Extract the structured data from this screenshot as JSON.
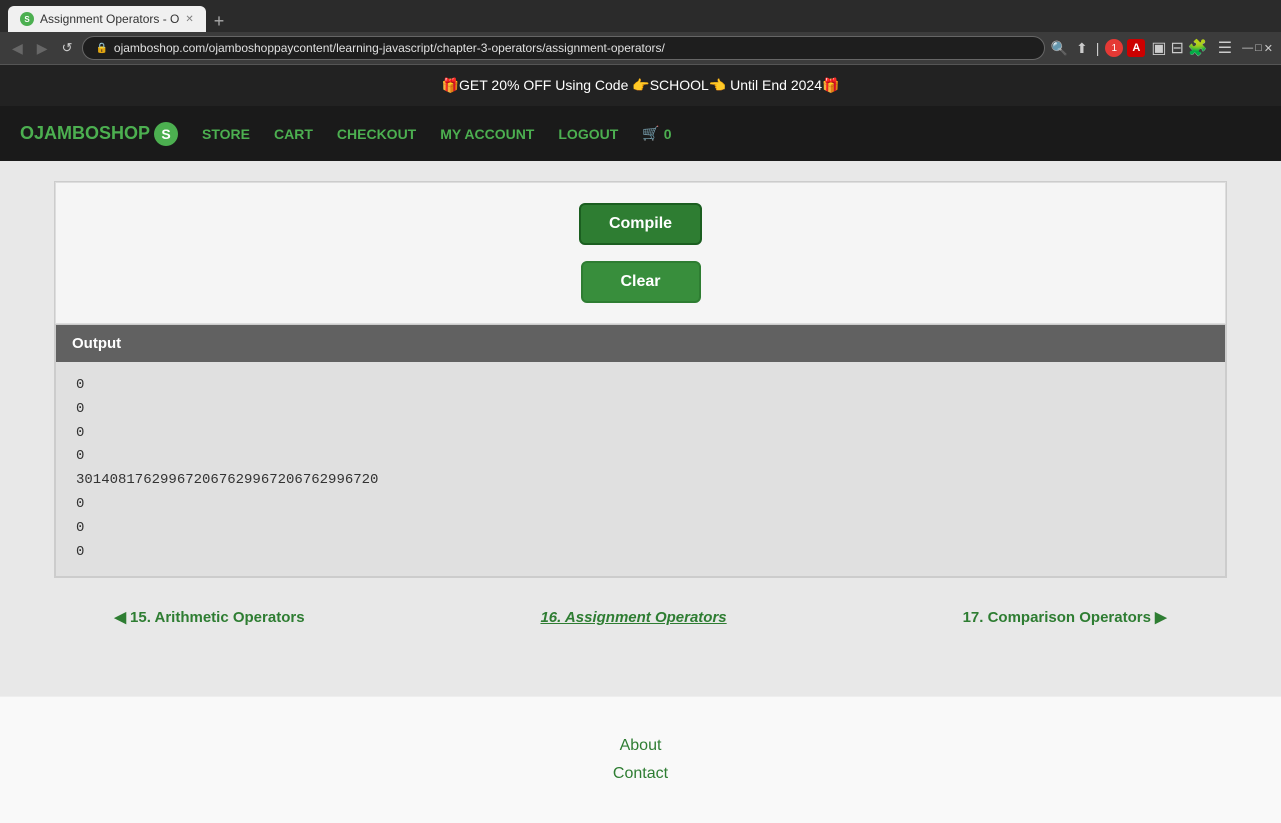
{
  "browser": {
    "tab_title": "Assignment Operators - O",
    "tab_favicon": "S",
    "new_tab_label": "+",
    "url": "ojamboshop.com/ojamboshoppaycontent/learning-javascript/chapter-3-operators/assignment-operators/",
    "back_btn": "◀",
    "forward_btn": "▶",
    "refresh_btn": "↺",
    "menu_btn": "☰",
    "reader_icon": "📖",
    "share_icon": "⬆",
    "rss_icon": ")",
    "ext1_count": "1",
    "ext2_icon": "A"
  },
  "promo": {
    "text": "🎁GET 20% OFF Using Code 👉SCHOOL👈 Until End 2024🎁"
  },
  "nav": {
    "logo_text": "OJAMBOSHOP",
    "logo_s": "S",
    "store": "STORE",
    "cart": "CART",
    "checkout": "CHECKOUT",
    "my_account": "MY ACCOUNT",
    "logout": "LOGOUT",
    "cart_icon": "🛒",
    "cart_count": "0"
  },
  "buttons": {
    "compile": "Compile",
    "clear": "Clear"
  },
  "output": {
    "header": "Output",
    "lines": [
      "0",
      "0",
      "0",
      "0",
      "301408176299672067629967206762996720",
      "0",
      "0",
      "0"
    ]
  },
  "lesson_nav": {
    "prev_arrow": "◀",
    "prev_label": "15. Arithmetic Operators",
    "current_label": "16. Assignment Operators",
    "next_label": "17. Comparison Operators",
    "next_arrow": "▶"
  },
  "footer": {
    "about": "About",
    "contact": "Contact"
  }
}
